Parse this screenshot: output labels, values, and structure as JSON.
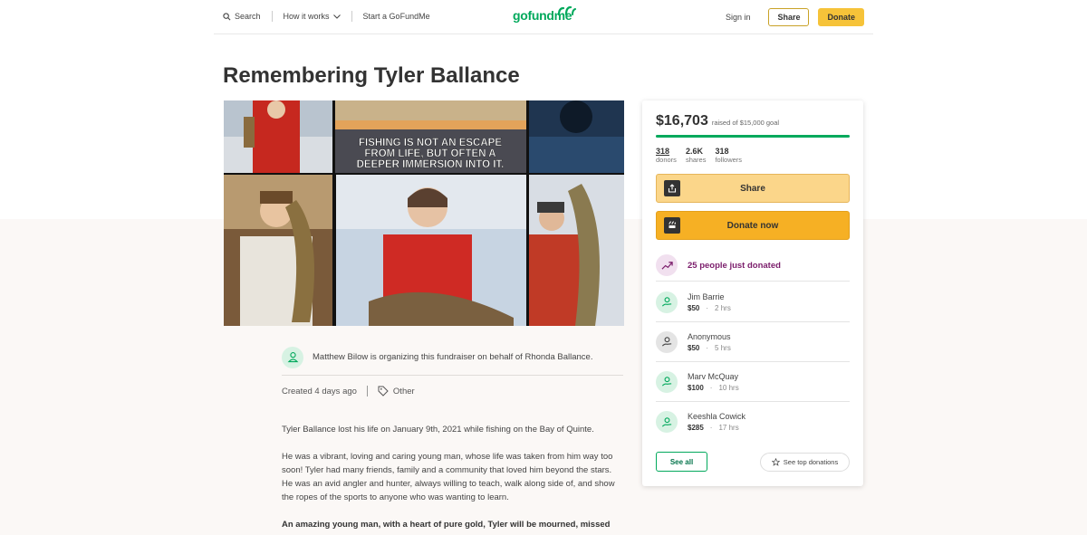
{
  "header": {
    "search_label": "Search",
    "how_it_works_label": "How it works",
    "start_label": "Start a GoFundMe",
    "logo_text": "gofundme",
    "signin_label": "Sign in",
    "share_label": "Share",
    "donate_label": "Donate"
  },
  "page_title": "Remembering Tyler Ballance",
  "hero": {
    "quote_lines": [
      "FISHING IS NOT AN ESCAPE",
      "FROM LIFE, BUT OFTEN A",
      "DEEPER IMMERSION INTO IT."
    ]
  },
  "organizer": {
    "text": "Matthew Bilow is organizing this fundraiser on behalf of Rhonda Ballance."
  },
  "meta": {
    "created": "Created 4 days ago",
    "category": "Other"
  },
  "story": {
    "p1": "Tyler Ballance lost his life on January 9th, 2021 while fishing on the Bay of Quinte.",
    "p2": "He was a vibrant, loving and caring young man, whose life was taken from him way too soon! Tyler had many friends, family and a community that loved him beyond the stars. He was an avid angler and hunter, always willing to teach, walk along side of, and show the ropes of the sports to anyone who was wanting to learn.",
    "p3": "An amazing young man, with a heart of pure gold, Tyler will be mourned, missed"
  },
  "card": {
    "raised": "$16,703",
    "goal_text": "raised of $15,000 goal",
    "progress_fraction": 1.0,
    "stats": [
      {
        "num": "318",
        "label": "donors"
      },
      {
        "num": "2.6K",
        "label": "shares"
      },
      {
        "num": "318",
        "label": "followers"
      }
    ],
    "share_label": "Share",
    "donate_label": "Donate now",
    "recent_text": "25 people just donated",
    "donations": [
      {
        "name": "Jim Barrie",
        "amount": "$50",
        "time": "2 hrs"
      },
      {
        "name": "Anonymous",
        "amount": "$50",
        "time": "5 hrs"
      },
      {
        "name": "Marv McQuay",
        "amount": "$100",
        "time": "10 hrs"
      },
      {
        "name": "Keeshla Cowick",
        "amount": "$285",
        "time": "17 hrs"
      }
    ],
    "see_all_label": "See all",
    "see_top_label": "See top donations"
  },
  "colors": {
    "brand_green": "#02a95c",
    "donate_yellow": "#f6b024",
    "recent_purple": "#7b1d6b"
  }
}
